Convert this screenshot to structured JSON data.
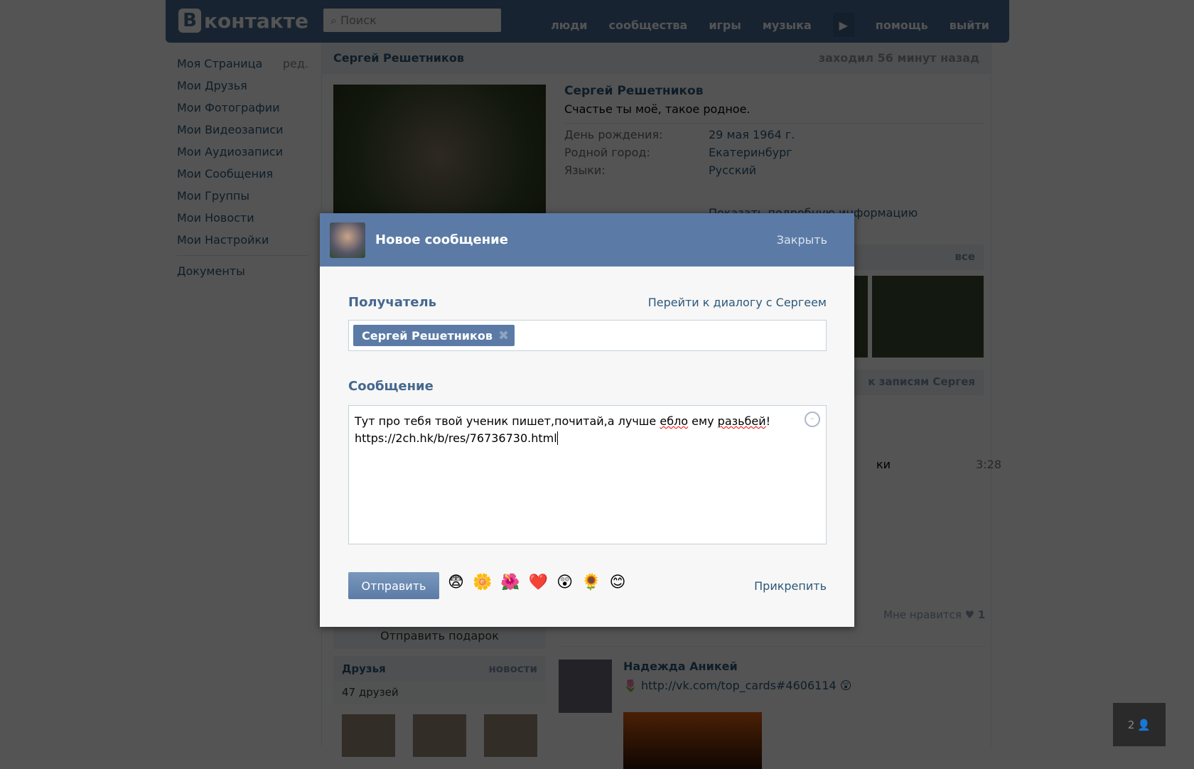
{
  "header": {
    "logo_text": "контакте",
    "logo_letter": "В",
    "search_placeholder": "Поиск",
    "nav": [
      "люди",
      "сообщества",
      "игры",
      "музыка",
      "помощь",
      "выйти"
    ]
  },
  "menu": {
    "items": [
      "Моя Страница",
      "Мои Друзья",
      "Мои Фотографии",
      "Мои Видеозаписи",
      "Мои Аудиозаписи",
      "Мои Сообщения",
      "Мои Группы",
      "Мои Новости",
      "Мои Настройки"
    ],
    "edit": "ред.",
    "documents": "Документы"
  },
  "profile": {
    "header_name": "Сергей Решетников",
    "last_seen": "заходил 56 минут назад",
    "name": "Сергей Решетников",
    "status": "Счастье ты моё, такое родное.",
    "fields": [
      {
        "k": "День рождения:",
        "v": "29 мая 1964 г."
      },
      {
        "k": "Родной город:",
        "v": "Екатеринбург"
      },
      {
        "k": "Языки:",
        "v": "Русский"
      }
    ],
    "more": "Показать подробную информацию",
    "photos_all": "все",
    "wall_link": "к записям Сергея",
    "audio_title_tail": "ки",
    "audio_duration": "3:28",
    "like_label": "Мне нравится",
    "like_count": "1",
    "gift": "Отправить подарок",
    "friends": {
      "title": "Друзья",
      "news": "новости",
      "count": "47 друзей"
    },
    "post": {
      "author": "Надежда Аникей",
      "link": "http://vk.com/top_cards#4606114"
    }
  },
  "widget": {
    "count": "2"
  },
  "modal": {
    "title": "Новое сообщение",
    "close": "Закрыть",
    "recipient_label": "Получатель",
    "dialog_link": "Перейти к диалогу с Сергеем",
    "recipient": "Сергей Решетников",
    "message_label": "Сообщение",
    "message_part1": "Тут про тебя твой ученик пишет,почитай,а лучше ",
    "message_sp1": "ебло",
    "message_part2": " ему ",
    "message_sp2": "разьбей",
    "message_part3": "!\n",
    "message_url": "https://2ch.hk/b/res/76736730.html",
    "send": "Отправить",
    "attach": "Прикрепить",
    "emojis": [
      "😨",
      "🌼",
      "🌺",
      "❤️",
      "😲",
      "🌻",
      "😊"
    ]
  }
}
